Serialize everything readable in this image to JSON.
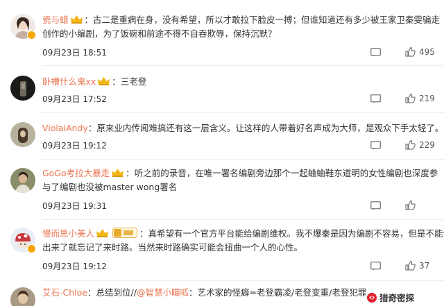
{
  "colors": {
    "username": "#eb7350",
    "text": "#333333",
    "meta": "#555555"
  },
  "comments": [
    {
      "username": "瓷与蜡",
      "has_crown": true,
      "colon": "：",
      "lines": [
        "古二是重病在身，没有希望，所以才敢拉下脸皮一搏；但谁知道还有多少被王家卫秦雯骗走",
        "创作的小编剧，为了饭碗和前途不得不自吞欺辱，保持沉默？"
      ],
      "time": "09月23日 18:51",
      "likes": "495"
    },
    {
      "username": "卧槽什么鬼xx",
      "has_crown": true,
      "colon": "：",
      "lines": [
        "三老登"
      ],
      "time": "09月23日 17:52",
      "likes": "219"
    },
    {
      "username": "ViolaiAndy",
      "colon": "：",
      "lines": [
        "原来业内传闻难搞还有这一层含义。让这样的人带着好名声成为大师，是观众下手太轻了。"
      ],
      "time": "09月23日 19:12",
      "likes": "229"
    },
    {
      "username": "GoGo考拉大暴走",
      "has_crown": true,
      "colon": "：",
      "lines": [
        "听之前的录音，在唯一署名编剧旁边那个一起蛐蛐鞋东道明的女性编剧也深度参",
        "与了编剧也没被master wong署名"
      ],
      "time": "09月23日 19:31",
      "likes": ""
    },
    {
      "username": "慢而思小美人",
      "has_crown": true,
      "has_level": true,
      "colon": "：",
      "lines": [
        "真希望有一个官方平台能给编剧维权。我不爆秦是因为编剧不容易，但是不能说",
        "出来了就忘记了来时路。当然来时路确实可能会扭曲一个人的心性。"
      ],
      "time": "09月23日 19:12",
      "likes": "37"
    },
    {
      "username": "艾石-Chloe",
      "colon": "：",
      "lines": [
        "总结到位//@智慧小瞄呱：艺术家的怪癖=老登霸凌/老登变重/老登犯罪"
      ],
      "mention": "@智慧小瞄呱",
      "time": "",
      "likes": ""
    }
  ],
  "watermark": "猎奇密探"
}
